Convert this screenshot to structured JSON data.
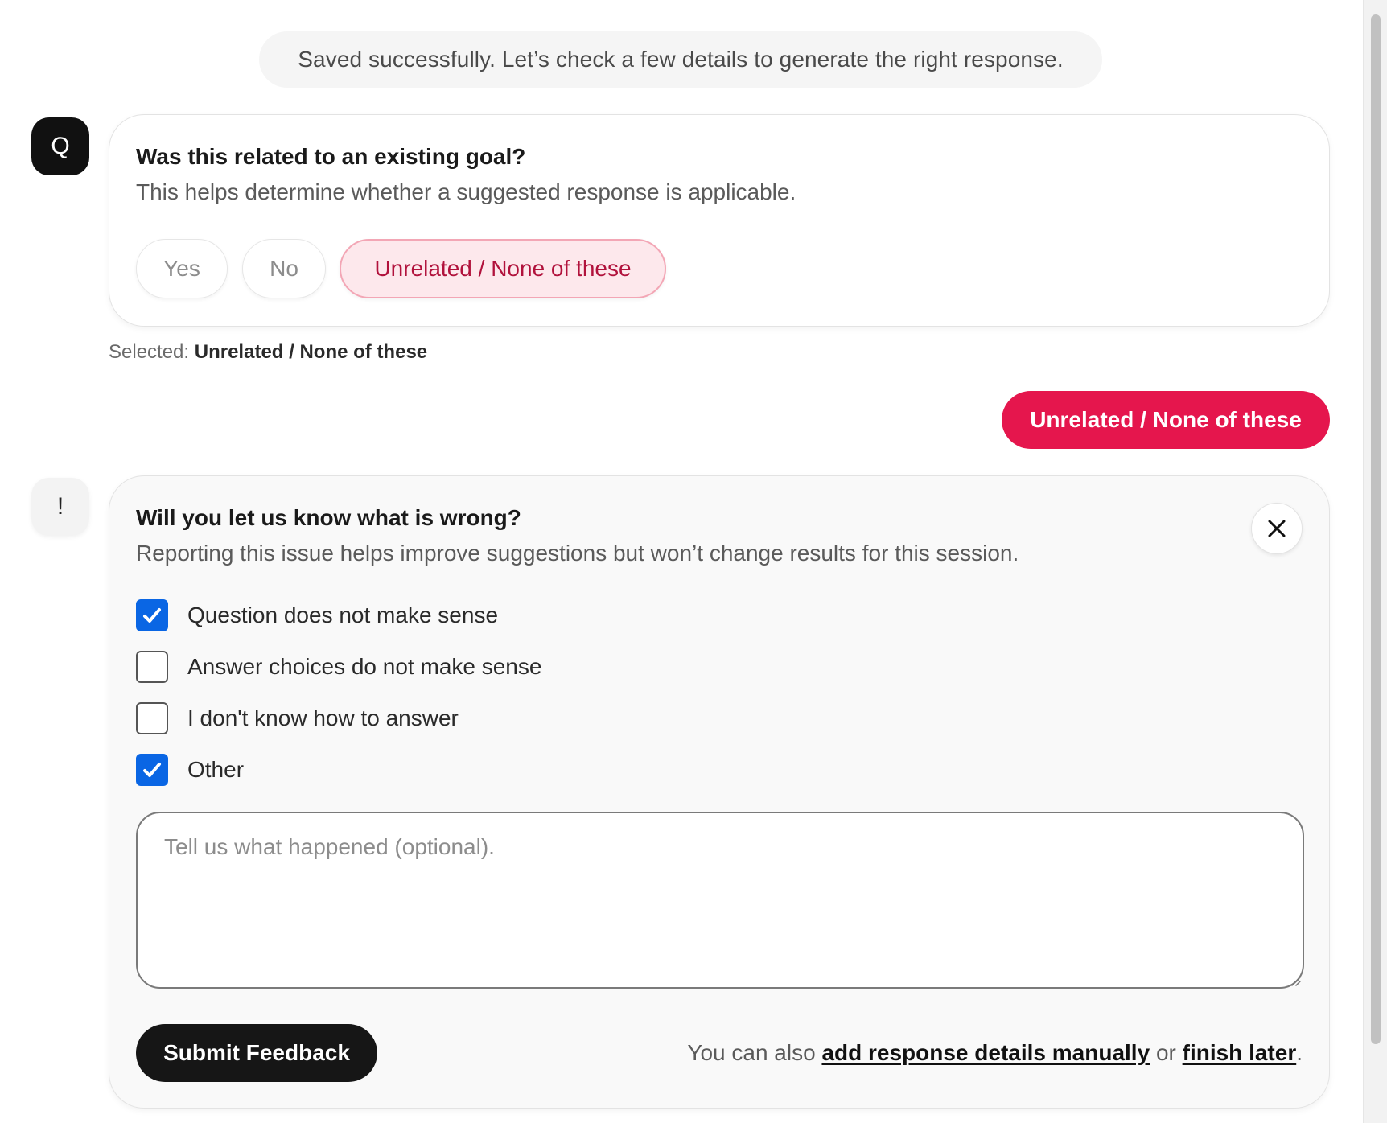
{
  "status_message": "Saved successfully. Let’s check a few details to generate the right response.",
  "avatars": {
    "question_letter": "Q",
    "issue_symbol": "!"
  },
  "goal_question": {
    "title": "Was this related to an existing goal?",
    "subtitle": "This helps determine whether a suggested response is applicable.",
    "choices": [
      {
        "label": "Yes",
        "selected": false
      },
      {
        "label": "No",
        "selected": false
      },
      {
        "label": "Unrelated / None of these",
        "selected": true
      }
    ]
  },
  "selection_summary": {
    "prefix": "Selected:",
    "value": "Unrelated / None of these"
  },
  "answer_bubble": "Unrelated / None of these",
  "issue_report": {
    "title": "Will you let us know what is wrong?",
    "subtitle": "Reporting this issue helps improve suggestions but won’t change results for this session.",
    "close_icon": "close-icon",
    "options": [
      {
        "label": "Question does not make sense",
        "checked": true
      },
      {
        "label": "Answer choices do not make sense",
        "checked": false
      },
      {
        "label": "I don't know how to answer",
        "checked": false
      },
      {
        "label": "Other",
        "checked": true
      }
    ],
    "feedback_placeholder": "Tell us what happened (optional).",
    "feedback_value": "",
    "submit_label": "Submit Feedback",
    "footer": {
      "prefix": "You can also",
      "manual_link": "add response details manually",
      "middle": "or",
      "later_link": "finish later",
      "suffix": "."
    }
  },
  "colors": {
    "accent": "#e5164d",
    "selected_choice_bg": "#fde8ec",
    "checkbox_checked": "#0a66e4",
    "primary_button": "#161616"
  }
}
